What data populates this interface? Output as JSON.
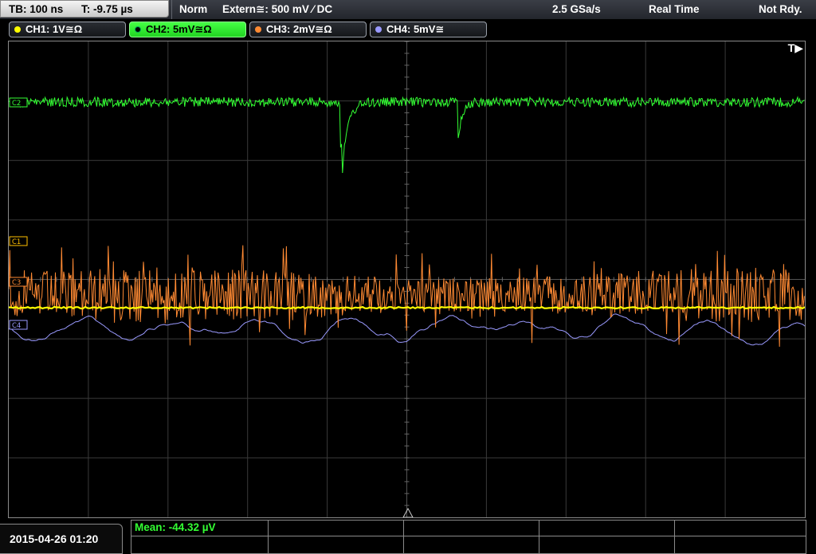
{
  "status_bar": {
    "timebase": "TB: 100 ns",
    "trigger_time": "T: -9.75 µs",
    "trigger_mode": "Norm",
    "trigger_source": "Extern≅: 500 mV ⁄ DC",
    "sample_rate": "2.5 GSa/s",
    "acquisition_mode": "Real Time",
    "run_state": "Not Rdy."
  },
  "channels": [
    {
      "label": "CH1: 1V≅Ω",
      "color": "#ffff00",
      "active": false
    },
    {
      "label": "CH2: 5mV≅Ω",
      "color": "#33ff33",
      "active": true
    },
    {
      "label": "CH3: 2mV≅Ω",
      "color": "#ff8a33",
      "active": false
    },
    {
      "label": "CH4: 5mV≅",
      "color": "#9a9aff",
      "active": false
    }
  ],
  "markers": {
    "c2": "C2",
    "c1": "C1",
    "c3": "C3",
    "c4": "C4",
    "trigger_position": "T▶"
  },
  "footer": {
    "datetime": "2015-04-26 01:20",
    "measurement": "Mean: -44.32 µV"
  },
  "colors": {
    "ch1": "#ffff00",
    "ch2": "#33ff33",
    "ch3": "#ff8a33",
    "ch4": "#9a9aff",
    "grid": "#3a3a3a"
  }
}
